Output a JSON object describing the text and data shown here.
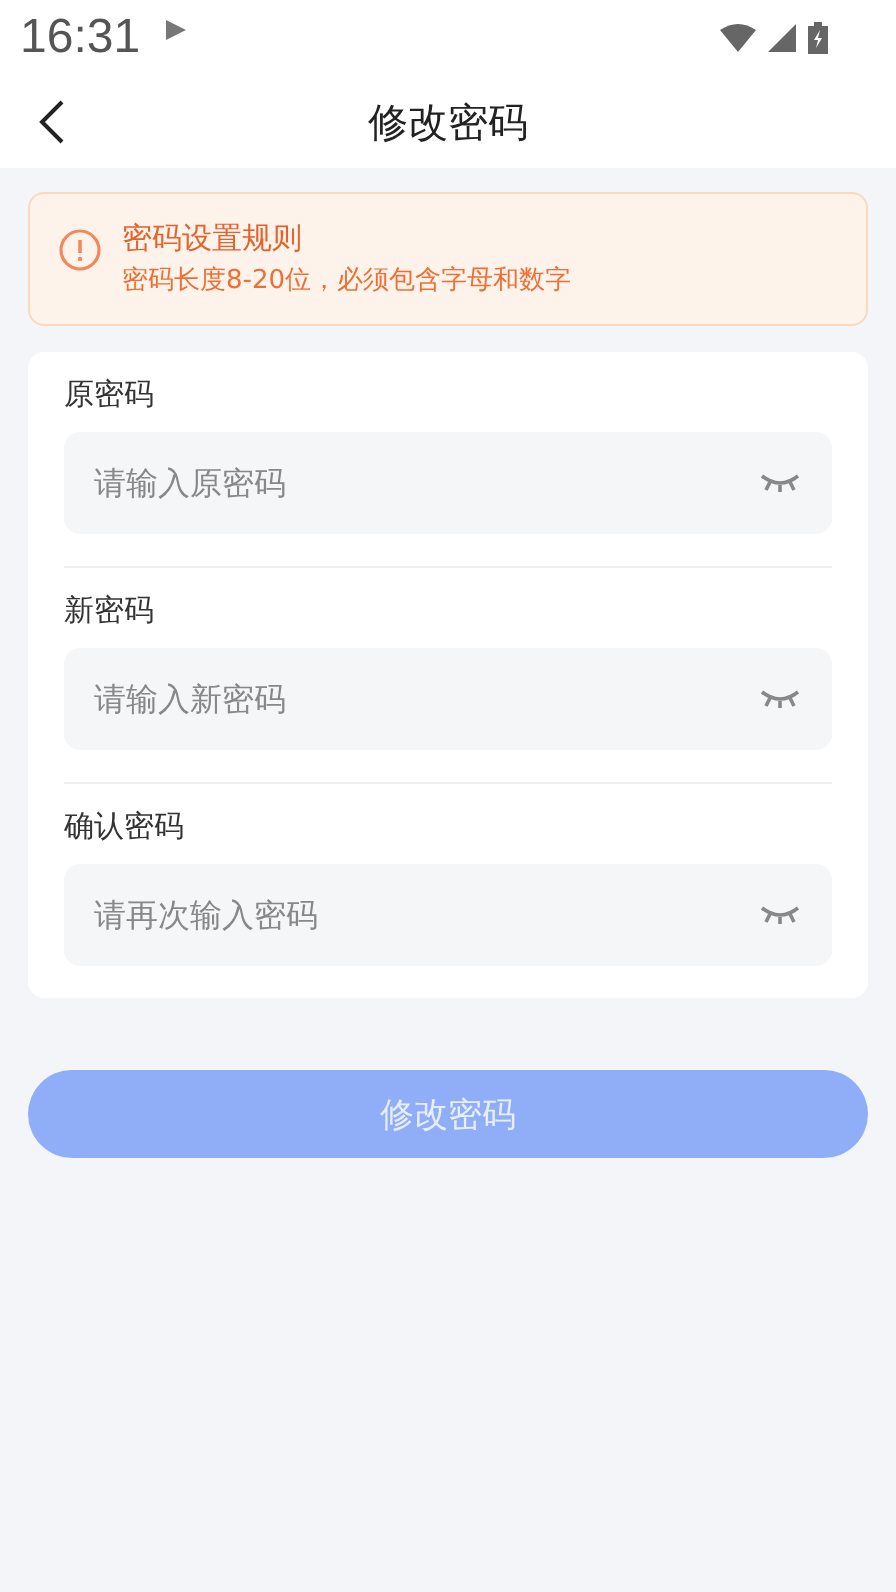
{
  "status_bar": {
    "time": "16:31"
  },
  "header": {
    "title": "修改密码"
  },
  "notice": {
    "title": "密码设置规则",
    "text": "密码长度8-20位，必须包含字母和数字"
  },
  "fields": [
    {
      "label": "原密码",
      "placeholder": "请输入原密码"
    },
    {
      "label": "新密码",
      "placeholder": "请输入新密码"
    },
    {
      "label": "确认密码",
      "placeholder": "请再次输入密码"
    }
  ],
  "submit": {
    "label": "修改密码",
    "disabled": true
  }
}
